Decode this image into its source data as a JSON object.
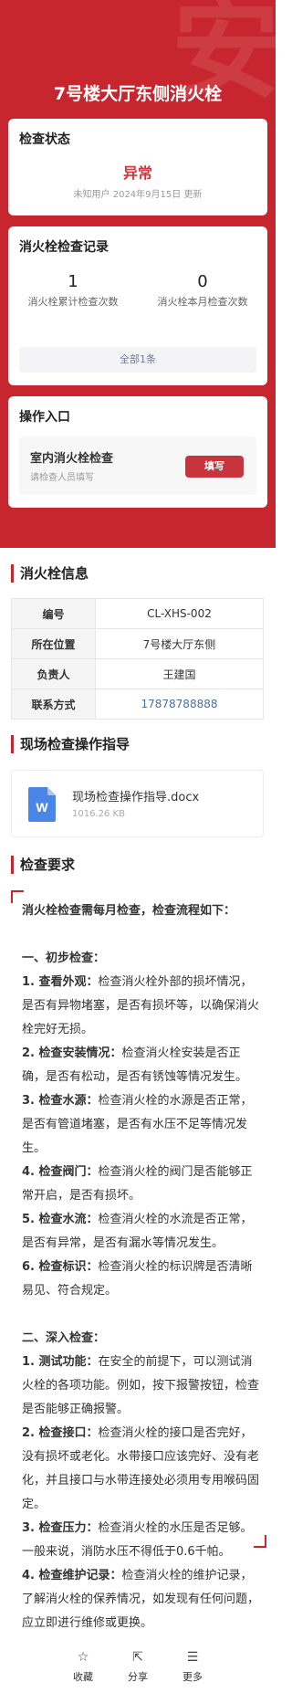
{
  "header": {
    "title": "7号楼大厅东侧消火栓"
  },
  "status_card": {
    "title": "检查状态",
    "value": "异常",
    "meta": "未知用户 2024年9月15日 更新",
    "accent": "#d0363c"
  },
  "record_card": {
    "title": "消火栓检查记录",
    "stats": [
      {
        "value": "1",
        "label": "消火栓累计检查次数"
      },
      {
        "value": "0",
        "label": "消火栓本月检查次数"
      }
    ],
    "all_button": "全部1条"
  },
  "entry_card": {
    "title": "操作入口",
    "item_name": "室内消火栓检查",
    "item_sub": "请检查人员填写",
    "fill_button": "填写"
  },
  "info": {
    "title": "消火栓信息",
    "rows": [
      {
        "key": "编号",
        "value": "CL-XHS-002"
      },
      {
        "key": "所在位置",
        "value": "7号楼大厅东侧"
      },
      {
        "key": "负责人",
        "value": "王建国"
      },
      {
        "key": "联系方式",
        "value": "17878788888"
      }
    ]
  },
  "guide": {
    "title": "现场检查操作指导",
    "file_name": "现场检查操作指导.docx",
    "file_size": "1016.26 KB",
    "file_icon": "word-doc-icon",
    "file_icon_letter": "W"
  },
  "requirements": {
    "title": "检查要求",
    "intro": "消火栓检查需每月检查，检查流程如下：",
    "sections": [
      {
        "heading": "一、初步检查：",
        "items": [
          {
            "label": "1. 查看外观：",
            "text": "检查消火栓外部的损坏情况，是否有异物堵塞，是否有损坏等，以确保消火栓完好无损。"
          },
          {
            "label": "2. 检查安装情况：",
            "text": "检查消火栓安装是否正确，是否有松动，是否有锈蚀等情况发生。"
          },
          {
            "label": "3. 检查水源：",
            "text": "检查消火栓的水源是否正常，是否有管道堵塞，是否有水压不足等情况发生。"
          },
          {
            "label": "4. 检查阀门：",
            "text": "检查消火栓的阀门是否能够正常开启，是否有损坏。"
          },
          {
            "label": "5. 检查水流：",
            "text": "检查消火栓的水流是否正常，是否有异常，是否有漏水等情况发生。"
          },
          {
            "label": "6. 检查标识：",
            "text": "检查消火栓的标识牌是否清晰易见、符合规定。"
          }
        ]
      },
      {
        "heading": "二、深入检查：",
        "items": [
          {
            "label": "1. 测试功能：",
            "text": "在安全的前提下，可以测试消火栓的各项功能。例如，按下报警按钮，检查是否能够正确报警。"
          },
          {
            "label": "2. 检查接口：",
            "text": "检查消火栓的接口是否完好，没有损坏或老化。水带接口应该完好、没有老化，并且接口与水带连接处必须用专用喉码固定。"
          },
          {
            "label": "3. 检查压力：",
            "text": "检查消火栓的水压是否足够。一般来说，消防水压不得低于0.6千帕。"
          },
          {
            "label": "4. 检查维护记录：",
            "text": "检查消火栓的维护记录，了解消火栓的保养情况，如发现有任何问题，应立即进行维修或更换。"
          }
        ]
      }
    ]
  },
  "bottom_nav": [
    {
      "label": "收藏",
      "icon": "star-icon",
      "glyph": "☆"
    },
    {
      "label": "分享",
      "icon": "share-icon",
      "glyph": "⇱"
    },
    {
      "label": "更多",
      "icon": "menu-icon",
      "glyph": "☰"
    }
  ],
  "colors": {
    "brand_red": "#c8262e",
    "link_blue": "#4a6fa5",
    "word_blue": "#4a86e8"
  }
}
